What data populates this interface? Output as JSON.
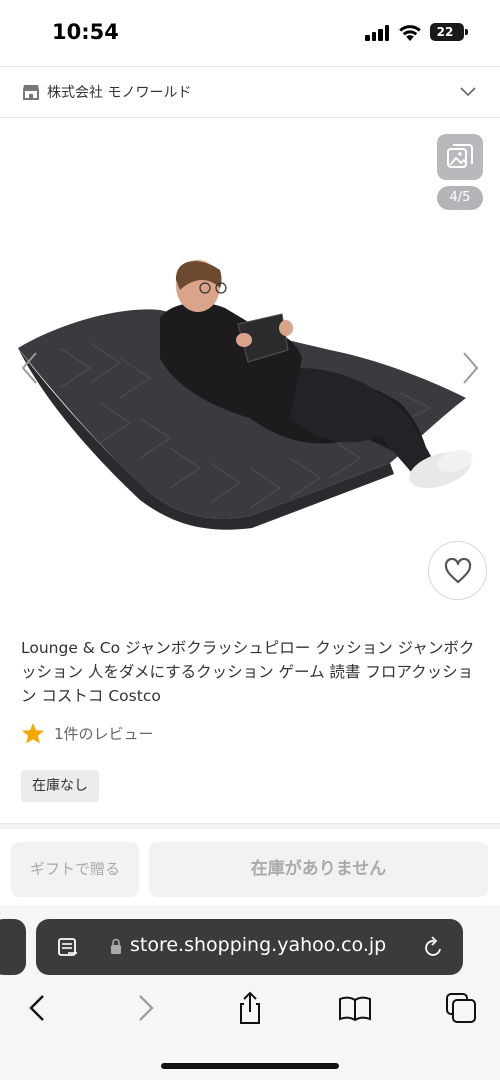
{
  "status_bar": {
    "time": "10:54",
    "battery": "22"
  },
  "store": {
    "name": "株式会社 モノワールド",
    "icon": "store-icon"
  },
  "gallery": {
    "counter": "4/5",
    "icons": [
      "gallery-icon",
      "chevron-left-icon",
      "chevron-right-icon",
      "heart-icon"
    ]
  },
  "product": {
    "title": "Lounge & Co ジャンボクラッシュピロー クッション ジャンボクッション 人をダメにするクッション ゲーム 読書 フロアクッション コストコ Costco",
    "review_text": "1件のレビュー",
    "stock_status": "在庫なし"
  },
  "actions": {
    "gift_label": "ギフトで贈る",
    "cart_label": "在庫がありません"
  },
  "browser": {
    "url": "store.shopping.yahoo.co.jp",
    "toolbar_icons": [
      "back-icon",
      "forward-icon",
      "share-icon",
      "bookmarks-icon",
      "tabs-icon"
    ]
  },
  "colors": {
    "star": "#f5a800",
    "url_bar_bg": "#3b3b3d",
    "cushion": "#3a3b3f"
  }
}
